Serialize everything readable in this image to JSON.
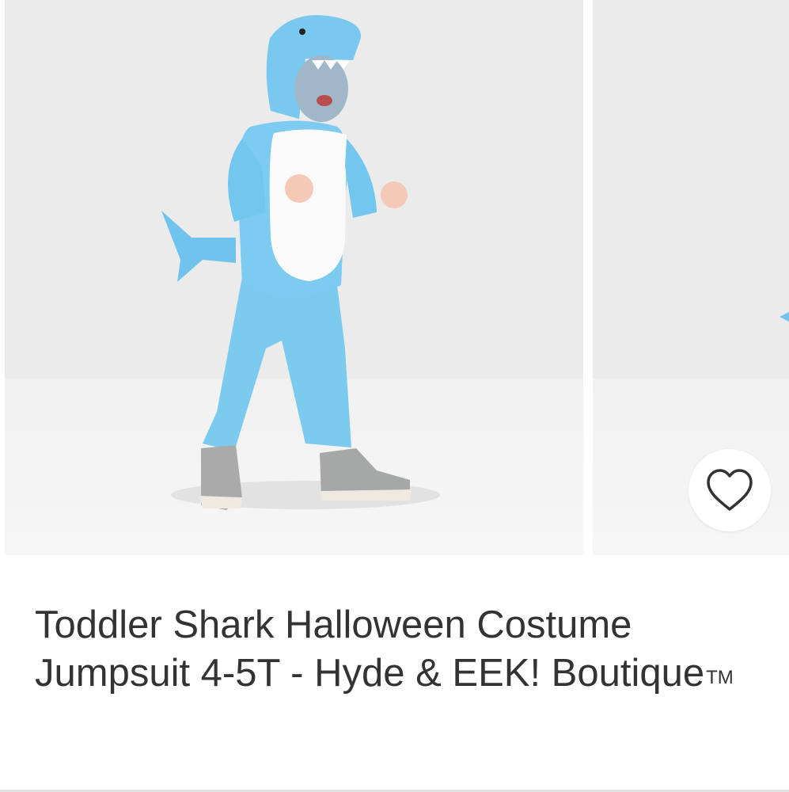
{
  "product": {
    "title": "Toddler Shark Halloween Costume Jumpsuit 4-5T - Hyde & EEK! Boutique",
    "trademark": "TM"
  },
  "gallery": {
    "favorite_icon": "heart-outline-icon"
  },
  "colors": {
    "background": "#ffffff",
    "photo_backdrop": "#ebebeb",
    "costume_blue": "#7fcbf0",
    "title_text": "#333333"
  }
}
